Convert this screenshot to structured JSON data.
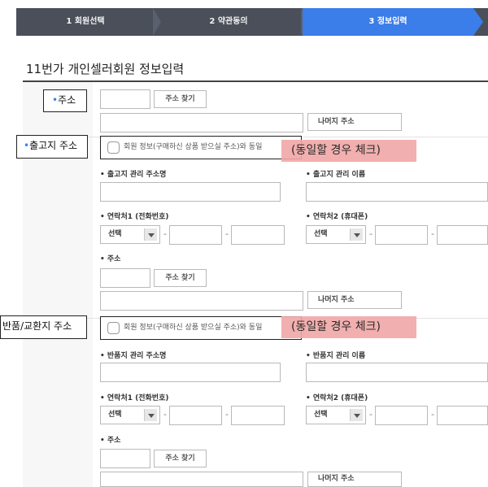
{
  "steps": [
    "1 회원선택",
    "2 약관동의",
    "3 정보입력"
  ],
  "title": "11번가 개인셀러회원 정보입력",
  "colors": {
    "active_step": "#3b7de9",
    "highlight": "#f1a7a7"
  },
  "address": {
    "label": "주소",
    "find_button": "주소 찾기",
    "remainder_label": "나머지 주소"
  },
  "shipping": {
    "label": "출고지 주소",
    "same_checkbox": "회원 정보(구매하신 상품 받으실 주소)와 동일",
    "note": "(동일할 경우 체크)",
    "name_label": "• 출고지 관리 주소명",
    "manager_label": "• 출고지 관리 이름",
    "phone1_label": "• 연락처1 (전화번호)",
    "phone2_label": "• 연락처2 (휴대폰)",
    "select_value": "선택",
    "addr_label": "• 주소",
    "find_button": "주소 찾기",
    "remainder_label": "나머지 주소"
  },
  "returns": {
    "label": "반품/교환지 주소",
    "same_checkbox": "회원 정보(구매하신 상품 받으실 주소)와 동일",
    "note": "(동일할 경우 체크)",
    "name_label": "• 반품지 관리 주소명",
    "manager_label": "• 반품지 관리 이름",
    "phone1_label": "• 연락처1 (전화번호)",
    "phone2_label": "• 연락처2 (휴대폰)",
    "select_value": "선택",
    "addr_label": "• 주소",
    "find_button": "주소 찾기",
    "remainder_label": "나머지 주소"
  }
}
